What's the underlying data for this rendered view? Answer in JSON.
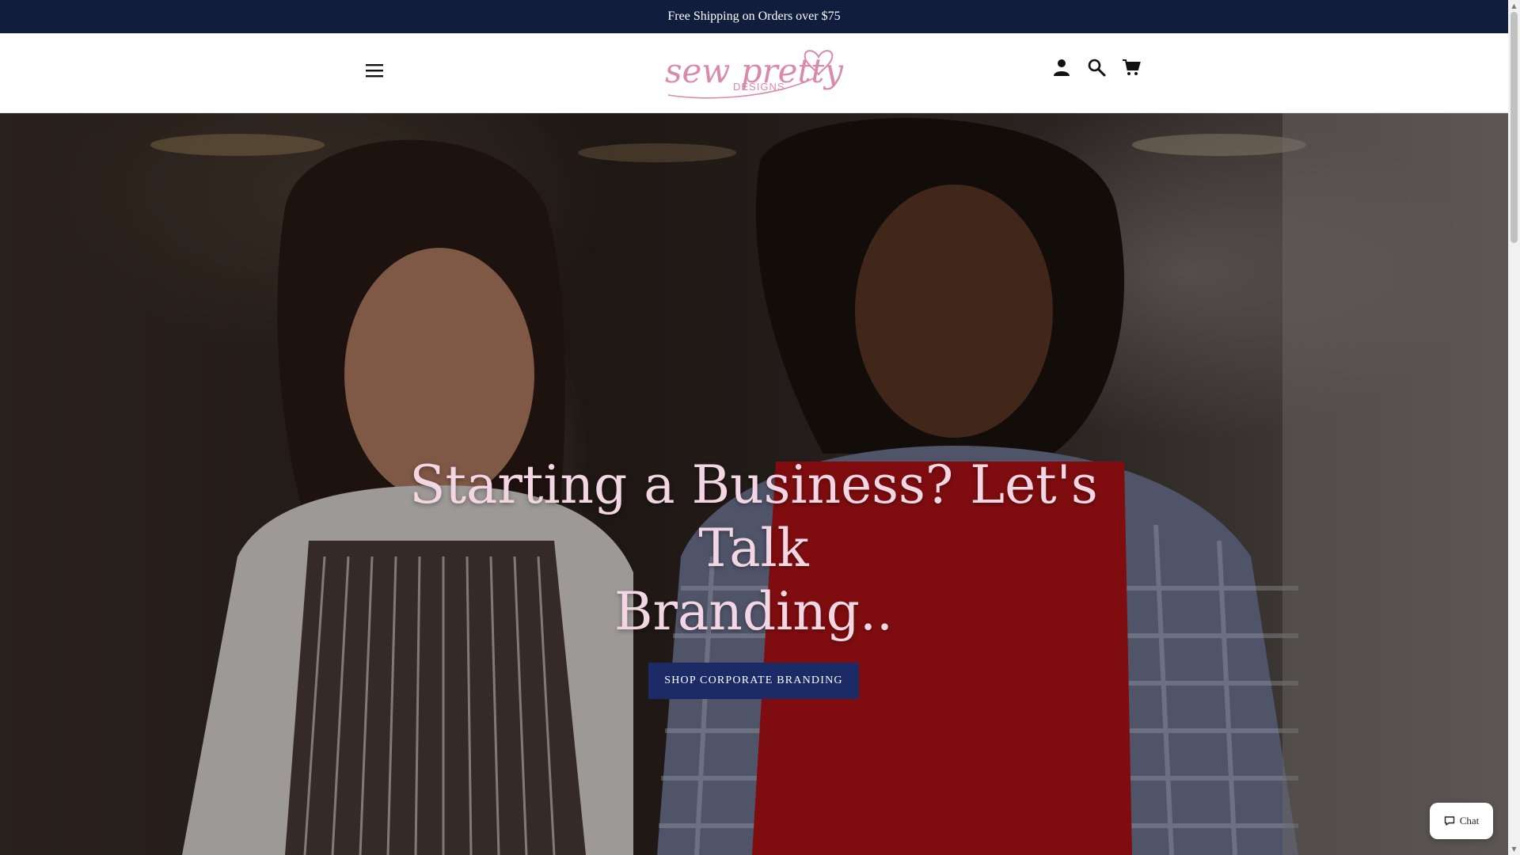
{
  "announcement": {
    "text": "Free Shipping on Orders over $75"
  },
  "header": {
    "logo": {
      "line1": "sew pretty",
      "line2": "DESIGNS"
    },
    "icons": [
      "menu-icon",
      "account-icon",
      "search-icon",
      "cart-icon"
    ]
  },
  "hero": {
    "title_line1": "Starting a Business? Let's Talk",
    "title_line2": "Branding..",
    "cta_label": "SHOP CORPORATE BRANDING"
  },
  "chat": {
    "label": "Chat"
  },
  "colors": {
    "announcement_bg": "#111d3d",
    "cta_bg": "#1c2a66",
    "title_color": "#f3d6e4",
    "logo_pink": "#d98aa9"
  }
}
